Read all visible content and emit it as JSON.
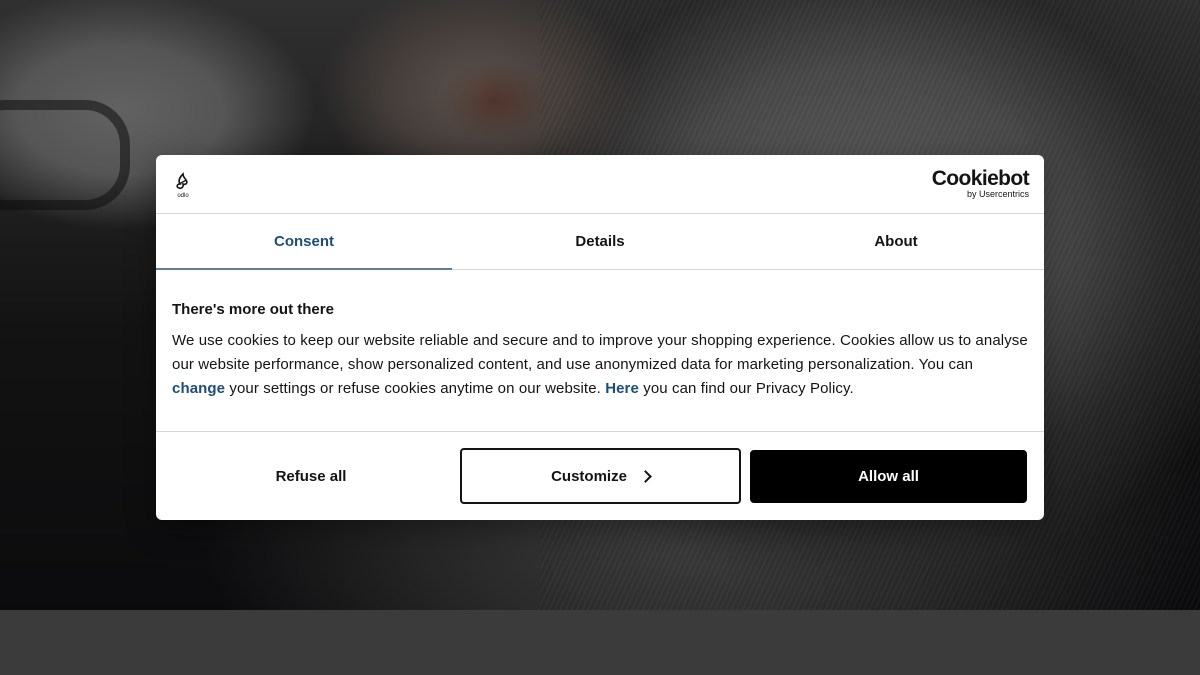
{
  "header": {
    "brand_logo_text": "odlo",
    "cookiebot_name": "Cookiebot",
    "cookiebot_by": "by Usercentrics"
  },
  "tabs": [
    {
      "label": "Consent",
      "active": true
    },
    {
      "label": "Details",
      "active": false
    },
    {
      "label": "About",
      "active": false
    }
  ],
  "body": {
    "title": "There's more out there",
    "text_part1": "We use cookies to keep our website reliable and secure and to improve your shopping experience. Cookies allow us to analyse our website performance, show personalized content, and use anonymized data for marketing personalization. You can ",
    "link_change": "change",
    "text_part2": " your settings or refuse cookies anytime on our website. ",
    "link_here": "Here",
    "text_part3": " you can find our Privacy Policy."
  },
  "footer": {
    "refuse_label": "Refuse all",
    "customize_label": "Customize",
    "allow_label": "Allow all"
  },
  "colors": {
    "accent": "#1d4d78",
    "text": "#141414",
    "allow_bg": "#000000"
  }
}
